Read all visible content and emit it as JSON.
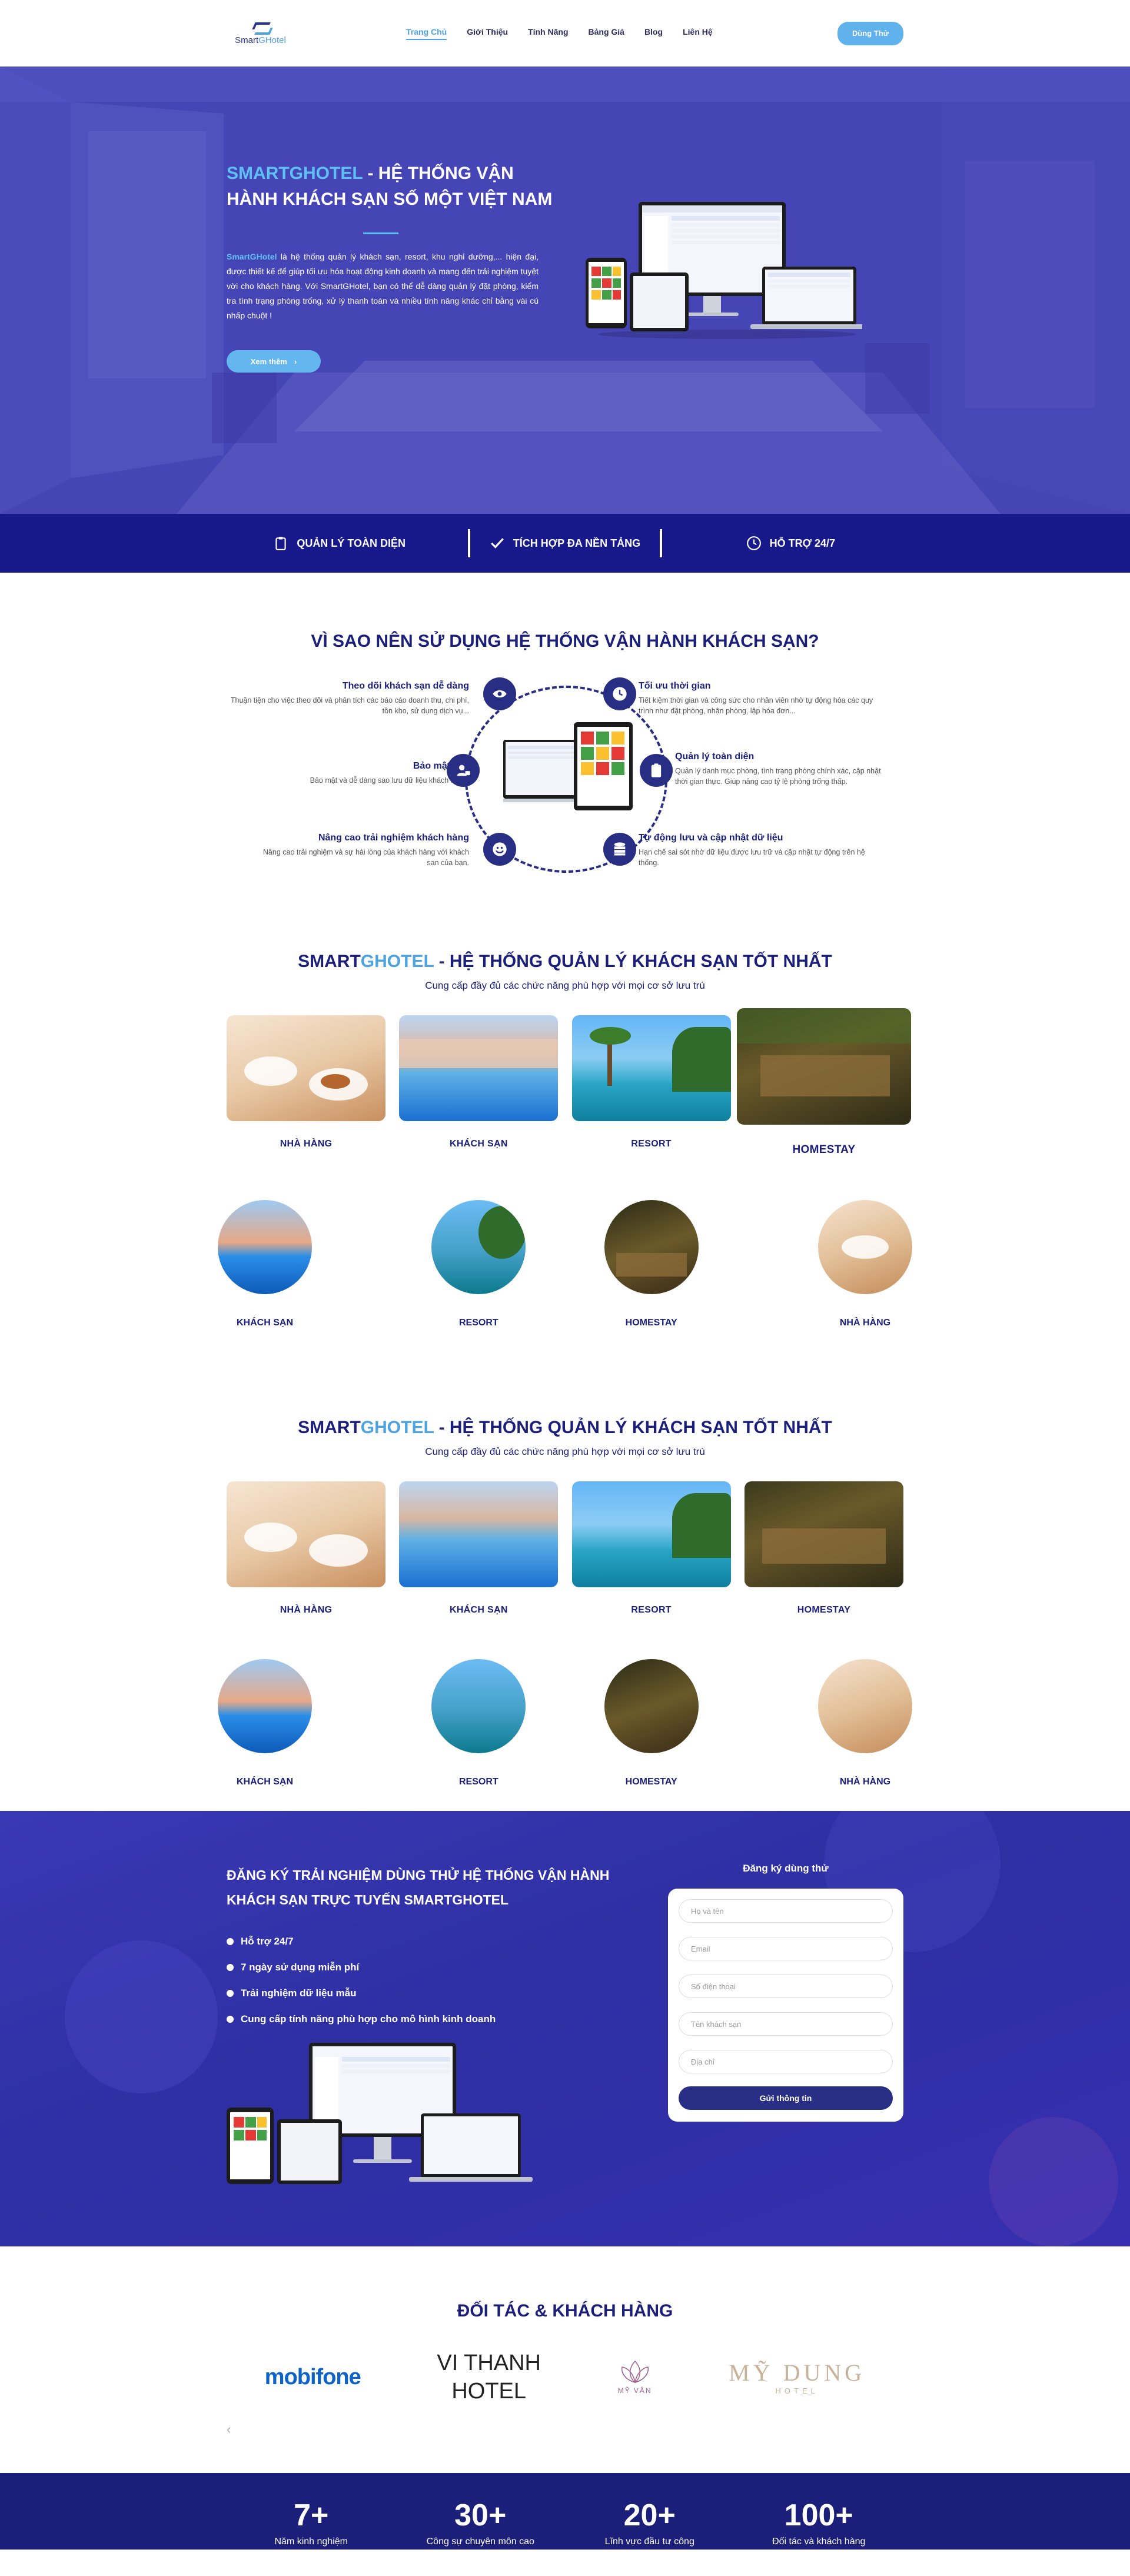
{
  "header": {
    "logo_main": "Smart",
    "logo_accent": "GHotel",
    "nav": [
      "Trang Chủ",
      "Giới Thiệu",
      "Tính Năng",
      "Bảng Giá",
      "Blog",
      "Liên Hệ"
    ],
    "cta": "Dùng Thử"
  },
  "hero": {
    "title_accent": "SMARTGHOTEL",
    "title_rest": " - HỆ THỐNG VẬN HÀNH KHÁCH SẠN SỐ MỘT VIỆT NAM",
    "desc_accent": "SmartGHotel",
    "desc_rest": " là hệ thống quản lý khách sạn, resort, khu nghỉ dưỡng,... hiện đại, được thiết kế để giúp tối ưu hóa hoạt động kinh doanh và mang đến trải nghiệm tuyệt vời cho khách hàng. Với SmartGHotel, bạn có thể dễ dàng quản lý đặt phòng, kiểm tra tình trạng phòng trống, xử lý thanh toán và nhiều tính năng khác chỉ bằng vài cú nhấp chuột !",
    "button": "Xem thêm"
  },
  "features_bar": [
    "QUẢN LÝ TOÀN DIỆN",
    "TÍCH HỢP ĐA NỀN TẢNG",
    "HỖ TRỢ 24/7"
  ],
  "why": {
    "title": "VÌ SAO NÊN SỬ DỤNG HỆ THỐNG VẬN HÀNH KHÁCH SẠN?",
    "items": [
      {
        "title": "Theo dõi khách sạn dễ dàng",
        "desc": "Thuận tiện cho việc theo dõi và phân tích các báo cáo doanh thu, chi phí, tồn kho, sử dụng dịch vụ..."
      },
      {
        "title": "Tối ưu thời gian",
        "desc": "Tiết kiệm thời gian và công sức cho nhân viên nhờ tự động hóa các quy trình như đặt phòng, nhận phòng, lập hóa đơn..."
      },
      {
        "title": "Bảo mật cao",
        "desc": "Bảo mật và dễ dàng sao lưu dữ liệu khách hàng."
      },
      {
        "title": "Quản lý toàn diện",
        "desc": "Quản lý danh mục phòng, tình trạng phòng chính xác, cập nhật thời gian thực. Giúp nâng cao tỷ lệ phòng trống thấp."
      },
      {
        "title": "Nâng cao trải nghiệm khách hàng",
        "desc": "Nâng cao trải nghiệm và sự hài lòng của khách hàng với khách sạn của bạn."
      },
      {
        "title": "Tự động lưu và cập nhật dữ liệu",
        "desc": "Hạn chế sai sót nhờ dữ liệu được lưu trữ và cập nhật tự động trên hệ thống."
      }
    ]
  },
  "hotel_sections": [
    {
      "title_a": "SMART",
      "title_b": "GHOTEL",
      "title_c": " - HỆ THỐNG QUẢN LÝ KHÁCH SẠN TỐT NHẤT",
      "subtitle": "Cung cấp đầy đủ các chức năng phù hợp với mọi cơ sở lưu trú",
      "cards": [
        "NHÀ HÀNG",
        "KHÁCH SẠN",
        "RESORT",
        "HOMESTAY"
      ],
      "rounds": [
        "KHÁCH SẠN",
        "RESORT",
        "HOMESTAY",
        "NHÀ HÀNG"
      ]
    },
    {
      "title_a": "SMART",
      "title_b": "GHOTEL",
      "title_c": " - HỆ THỐNG QUẢN LÝ KHÁCH SẠN TỐT NHẤT",
      "subtitle": "Cung cấp đầy đủ các chức năng phù hợp với mọi cơ sở lưu trú",
      "cards": [
        "NHÀ HÀNG",
        "KHÁCH SẠN",
        "RESORT",
        "HOMESTAY"
      ],
      "rounds": [
        "KHÁCH SẠN",
        "RESORT",
        "HOMESTAY",
        "NHÀ HÀNG"
      ]
    }
  ],
  "register": {
    "title": "ĐĂNG KÝ TRẢI NGHIỆM DÙNG THỬ HỆ THỐNG VẬN HÀNH KHÁCH SẠN TRỰC TUYẾN SMARTGHOTEL",
    "benefits": [
      "Hỗ trợ 24/7",
      "7 ngày sử dụng miễn phí",
      "Trải nghiệm dữ liệu mẫu",
      "Cung cấp tính năng phù hợp cho mô hình kinh doanh"
    ],
    "form_title": "Đăng ký dùng thử",
    "fields": [
      "Họ và tên",
      "Email",
      "Số điện thoại",
      "Tên khách sạn",
      "Địa chỉ"
    ],
    "submit": "Gửi thông tin"
  },
  "partners": {
    "title": "ĐỐI TÁC & KHÁCH HÀNG",
    "logos": {
      "mobifone": "mobifone",
      "vithanh_1": "VI THANH",
      "vithanh_2": "HOTEL",
      "myvan": "MỸ VÂN",
      "mydung_1": "MỸ DUNG",
      "mydung_2": "HOTEL"
    },
    "arrow_left": "‹"
  },
  "stats": [
    {
      "num": "7+",
      "label": "Năm kinh nghiệm"
    },
    {
      "num": "30+",
      "label": "Công sự chuyên môn cao"
    },
    {
      "num": "20+",
      "label": "Lĩnh vực đầu tư công"
    },
    {
      "num": "100+",
      "label": "Đối tác và khách hàng"
    }
  ]
}
